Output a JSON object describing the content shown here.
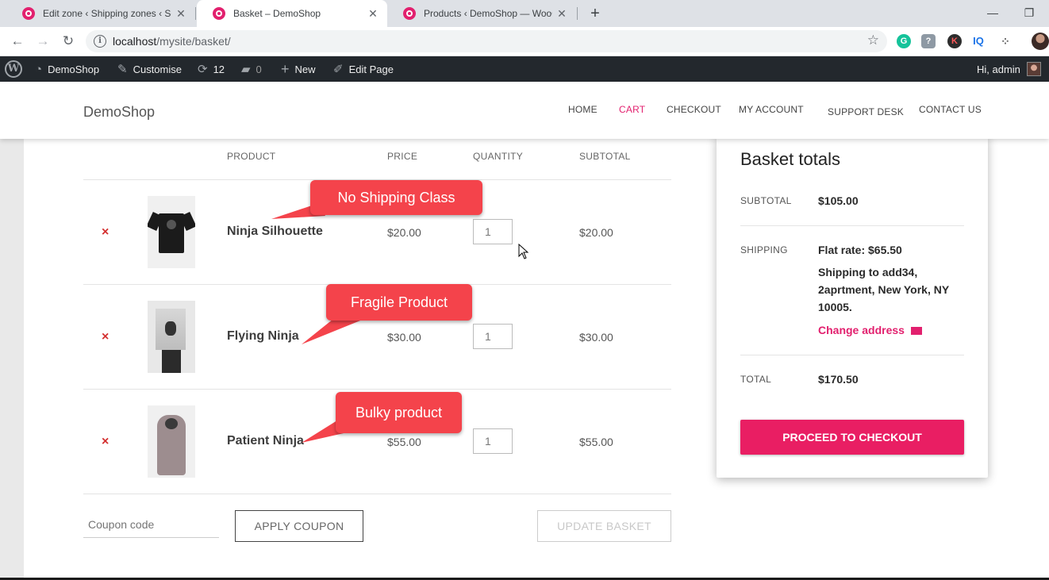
{
  "browser": {
    "tabs": [
      {
        "title": "Edit zone ‹ Shipping zones ‹ Setti"
      },
      {
        "title": "Basket – DemoShop"
      },
      {
        "title": "Products ‹ DemoShop — WooCo"
      }
    ],
    "url_host": "localhost",
    "url_path": "/mysite/basket/",
    "extensions": [
      "G",
      "K",
      "IQ"
    ]
  },
  "admin_bar": {
    "site": "DemoShop",
    "customise": "Customise",
    "updates": "12",
    "comments": "0",
    "new": "New",
    "edit_page": "Edit Page",
    "greeting": "Hi, admin"
  },
  "site": {
    "title": "DemoShop",
    "menu": [
      "HOME",
      "CART",
      "CHECKOUT",
      "MY ACCOUNT",
      "SUPPORT DESK",
      "CONTACT US"
    ]
  },
  "cart": {
    "headers": {
      "product": "PRODUCT",
      "price": "PRICE",
      "quantity": "QUANTITY",
      "subtotal": "SUBTOTAL"
    },
    "items": [
      {
        "name": "Ninja Silhouette",
        "price": "$20.00",
        "qty": "1",
        "subtotal": "$20.00",
        "callout": "No Shipping Class"
      },
      {
        "name": "Flying Ninja",
        "price": "$30.00",
        "qty": "1",
        "subtotal": "$30.00",
        "callout": "Fragile Product"
      },
      {
        "name": "Patient Ninja",
        "price": "$55.00",
        "qty": "1",
        "subtotal": "$55.00",
        "callout": "Bulky product"
      }
    ],
    "remove_symbol": "×",
    "coupon_placeholder": "Coupon code",
    "apply_coupon": "APPLY COUPON",
    "update_basket": "UPDATE BASKET"
  },
  "totals": {
    "title": "Basket totals",
    "subtotal_label": "SUBTOTAL",
    "subtotal_value": "$105.00",
    "shipping_label": "SHIPPING",
    "shipping_method": "Flat rate: $65.50",
    "shipping_to": "Shipping to add34, 2aprtment, New York, NY 10005.",
    "change_address": "Change address",
    "total_label": "TOTAL",
    "total_value": "$170.50",
    "checkout_button": "PROCEED TO CHECKOUT"
  },
  "colors": {
    "accent": "#e2206e",
    "checkout": "#e91e63",
    "callout": "#f4434b",
    "remove": "#d32f2f",
    "admin_bar": "#23282d"
  }
}
